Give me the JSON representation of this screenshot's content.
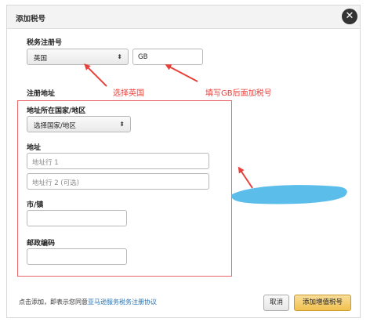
{
  "dialog": {
    "title": "添加税号",
    "close_icon": "close-icon"
  },
  "tax_registration": {
    "label": "税务注册号",
    "country_selected": "英国",
    "number_value": "GB"
  },
  "registered_address": {
    "section_label": "注册地址",
    "country_region_label": "地址所在国家/地区",
    "country_region_selected": "选择国家/地区",
    "address_label": "地址",
    "address_line1_placeholder": "地址行 1",
    "address_line2_placeholder": "地址行 2 (可选)",
    "city_label": "市/镇",
    "postal_code_label": "邮政编码"
  },
  "annotations": {
    "select_uk": "选择英国",
    "fill_gb": "填写GB后面加税号"
  },
  "footer": {
    "notice_prefix": "点击添加，即表示您同意",
    "notice_link": "亚马逊服务税务注册协议",
    "cancel_label": "取消",
    "add_vat_label": "添加增值税号"
  },
  "colors": {
    "annotation_red": "#e8413c",
    "primary_button": "#f1c14f",
    "link_blue": "#1f6fb2",
    "redaction_blue": "#4db8e8"
  }
}
